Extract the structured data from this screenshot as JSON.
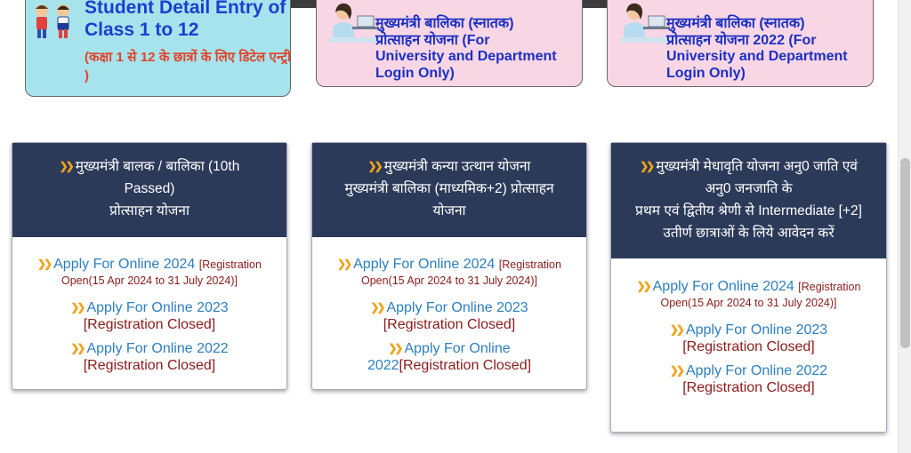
{
  "banners": {
    "student": {
      "title": "Student Detail Entry of Class 1 to 12",
      "subtitle": "(कक्षा 1 से 12 के छात्रों के लिए डिटेल एन्ट्री )"
    },
    "graduate_1": {
      "line1": "मुख्यमंत्री बालिका (स्नातक)",
      "line2": "प्रोत्साहन योजना (For",
      "line3": "University and Department",
      "line4": "Login Only)"
    },
    "graduate_2": {
      "line1": "मुख्यमंत्री बालिका (स्नातक)",
      "line2": "प्रोत्साहन योजना 2022 (For",
      "line3": "University and Department",
      "line4": "Login Only)"
    }
  },
  "cards": [
    {
      "head_lines": [
        "मुख्यमंत्री बालक / बालिका (10th",
        "Passed)",
        "प्रोत्साहन योजना"
      ],
      "items": [
        {
          "link": "Apply For Online 2024",
          "note_a": "[Registration",
          "note_b": "Open(15 Apr 2024 to 31 July 2024)]"
        },
        {
          "link": "Apply For Online 2023",
          "closed": "[Registration Closed]"
        },
        {
          "link": "Apply For Online 2022",
          "closed": "[Registration Closed]"
        }
      ]
    },
    {
      "head_lines": [
        "मुख्यमंत्री कन्या उत्थान योजना",
        "मुख्यमंत्री बालिका (माध्यमिक+2) प्रोत्साहन",
        "योजना"
      ],
      "items": [
        {
          "link": "Apply For Online 2024",
          "note_a": "[Registration",
          "note_b": "Open(15 Apr 2024 to 31 July 2024)]"
        },
        {
          "link": "Apply For Online 2023",
          "closed": "[Registration Closed]"
        },
        {
          "link_a": "Apply For Online",
          "link_b": "2022",
          "closed": "[Registration Closed]"
        }
      ]
    },
    {
      "head_lines": [
        "मुख्यमंत्री मेधावृति योजना अनु0 जाति एवं",
        "अनु0 जनजाति के",
        "प्रथम एवं द्वितीय श्रेणी से Intermediate [+2]",
        "उतीर्ण छात्राओं के लिये आवेदन करें"
      ],
      "items": [
        {
          "link": "Apply For Online 2024",
          "note_a": "[Registration",
          "note_b": "Open(15 Apr 2024 to 31 July 2024)]"
        },
        {
          "link": "Apply For Online 2023",
          "closed": "[Registration Closed]"
        },
        {
          "link": "Apply For Online 2022",
          "closed": "[Registration Closed]"
        }
      ]
    }
  ],
  "colors": {
    "card_header": "#2c3a5a",
    "link": "#2c7fc0",
    "closed_text": "#8a1b1b",
    "bullet": "#f2a21a",
    "student_banner_bg": "#a6e3ec",
    "graduate_banner_bg": "#f9d6e4"
  },
  "icons": {
    "bullet": "double-chevron-right-icon",
    "student_banner": "school-kids-icon",
    "graduate_banner": "girl-studying-icon"
  }
}
